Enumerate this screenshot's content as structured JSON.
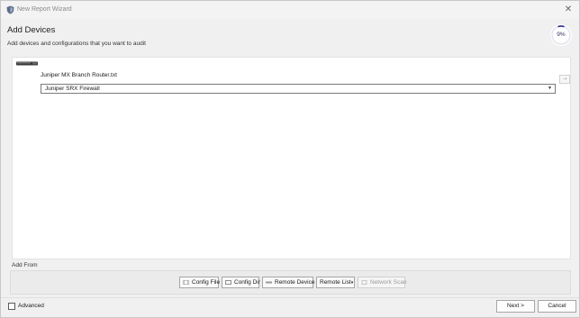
{
  "window": {
    "title": "New Report Wizard",
    "close_glyph": "✕"
  },
  "header": {
    "title": "Add Devices",
    "subtitle": "Add devices and configurations that you want to audit",
    "progress_text": "9%",
    "progress_fraction": 0.09,
    "progress_color": "#3b3b8f"
  },
  "devices": [
    {
      "filename": "Juniper MX Branch Router.txt",
      "device_type": "Juniper SRX Firewall",
      "thumb_icon": "device-thumbnail-icon"
    }
  ],
  "add_from": {
    "label": "Add From",
    "buttons": [
      {
        "label": "Config File",
        "icon": "file-icon",
        "enabled": true
      },
      {
        "label": "Config Dir",
        "icon": "folder-icon",
        "enabled": true
      },
      {
        "label": "Remote Device",
        "icon": "remote-device-icon",
        "enabled": true
      },
      {
        "label": "Remote List",
        "icon": "dropdown-caret-icon",
        "enabled": true,
        "suffix": "▾"
      },
      {
        "label": "Network Scan",
        "icon": "network-scan-icon",
        "enabled": false
      }
    ]
  },
  "footer": {
    "advanced_label": "Advanced",
    "advanced_checked": false,
    "next_label": "Next >",
    "cancel_label": "Cancel"
  }
}
